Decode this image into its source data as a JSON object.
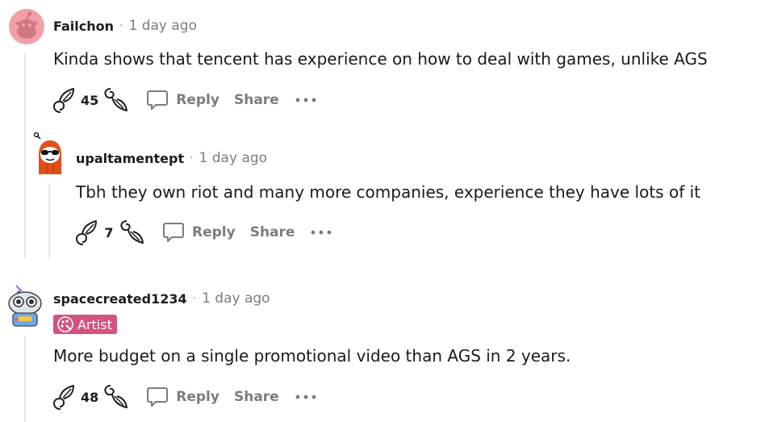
{
  "comments": [
    {
      "author": "Failchon",
      "separator": "·",
      "time": "1 day ago",
      "body": "Kinda shows that tencent has experience on how to deal with games, unlike AGS",
      "score": "45",
      "reply_label": "Reply",
      "share_label": "Share"
    },
    {
      "author": "upaltamentept",
      "separator": "·",
      "time": "1 day ago",
      "body": "Tbh they own riot and many more companies, experience they have lots of it",
      "score": "7",
      "reply_label": "Reply",
      "share_label": "Share"
    },
    {
      "author": "spacecreated1234",
      "separator": "·",
      "time": "1 day ago",
      "flair": "Artist",
      "body": "More budget on a single promotional video than AGS in 2 years.",
      "score": "48",
      "reply_label": "Reply",
      "share_label": "Share"
    }
  ],
  "icons": {
    "upvote": "sprout-upvote-icon",
    "downvote": "sprout-downvote-icon",
    "reply": "speech-bubble-icon",
    "more": "ellipsis-icon",
    "flair": "palette-icon"
  },
  "colors": {
    "flair_bg": "#d4537d",
    "avatar1_bg": "#f2a0a8",
    "avatar2_accent": "#e04e1b",
    "muted_text": "#7c7c7c"
  }
}
